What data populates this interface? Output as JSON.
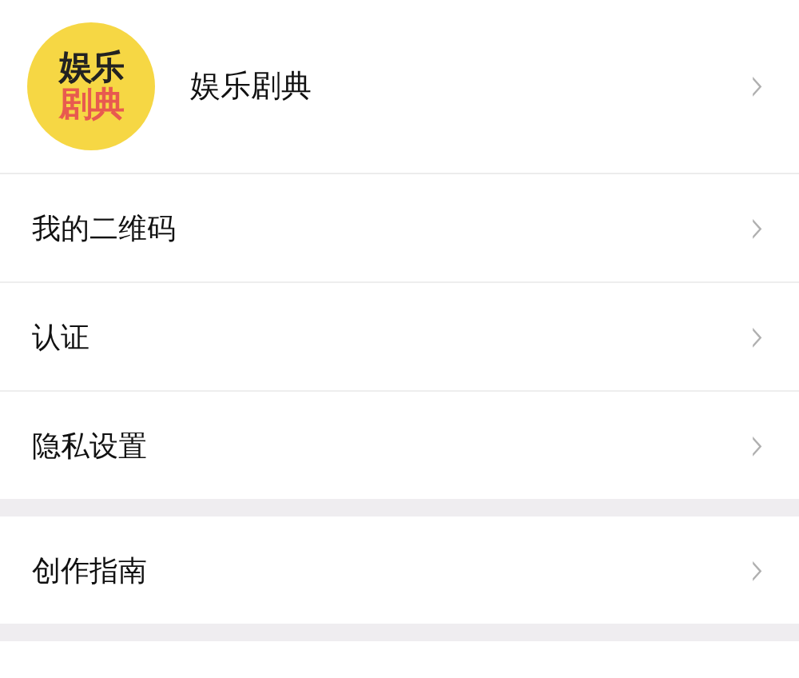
{
  "profile": {
    "avatar_lines": [
      "娱乐",
      "剧典"
    ],
    "name": "娱乐剧典",
    "chevron": "›"
  },
  "sections": [
    {
      "items": [
        {
          "label": "我的二维码",
          "chevron": "›"
        },
        {
          "label": "认证",
          "chevron": "›"
        },
        {
          "label": "隐私设置",
          "chevron": "›"
        }
      ]
    },
    {
      "items": [
        {
          "label": "创作指南",
          "chevron": "›"
        }
      ]
    }
  ]
}
